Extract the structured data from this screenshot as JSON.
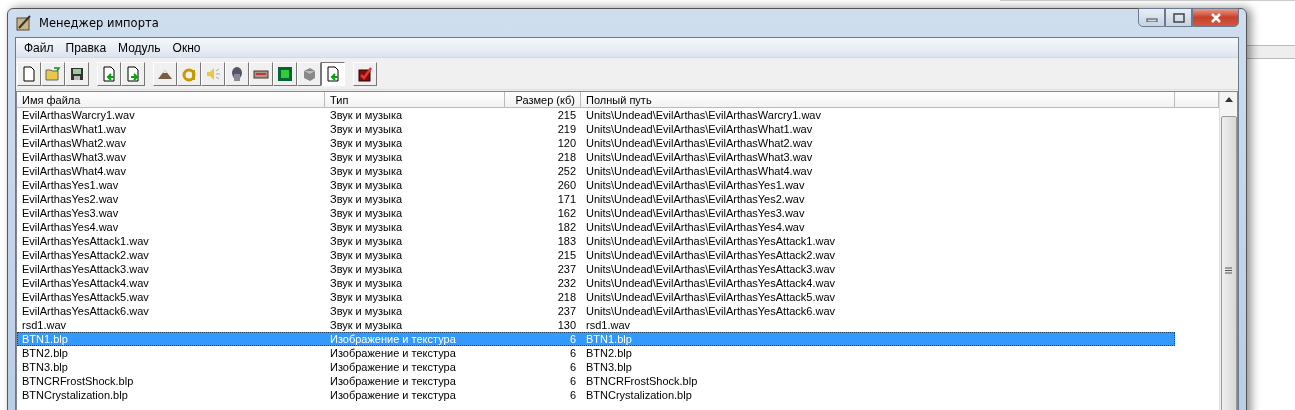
{
  "window": {
    "title": "Менеджер импорта"
  },
  "menu": [
    "Файл",
    "Правка",
    "Модуль",
    "Окно"
  ],
  "toolbar": [
    {
      "pressed": false
    },
    {
      "pressed": false
    },
    {
      "pressed": false
    },
    {
      "pressed": false
    },
    {
      "pressed": false
    },
    {
      "pressed": false
    },
    {
      "pressed": false
    },
    {
      "pressed": false
    },
    {
      "pressed": false
    },
    {
      "pressed": false
    },
    {
      "pressed": false
    },
    {
      "pressed": false
    },
    {
      "pressed": true
    },
    {
      "pressed": false
    }
  ],
  "table": {
    "columns": [
      "Имя файла",
      "Тип",
      "Размер (кб)",
      "Полный путь"
    ],
    "rows": [
      {
        "name": "EvilArthasWarcry1.wav",
        "type": "Звук и музыка",
        "size": "215",
        "path": "Units\\Undead\\EvilArthas\\EvilArthasWarcry1.wav",
        "selected": false
      },
      {
        "name": "EvilArthasWhat1.wav",
        "type": "Звук и музыка",
        "size": "219",
        "path": "Units\\Undead\\EvilArthas\\EvilArthasWhat1.wav",
        "selected": false
      },
      {
        "name": "EvilArthasWhat2.wav",
        "type": "Звук и музыка",
        "size": "120",
        "path": "Units\\Undead\\EvilArthas\\EvilArthasWhat2.wav",
        "selected": false
      },
      {
        "name": "EvilArthasWhat3.wav",
        "type": "Звук и музыка",
        "size": "218",
        "path": "Units\\Undead\\EvilArthas\\EvilArthasWhat3.wav",
        "selected": false
      },
      {
        "name": "EvilArthasWhat4.wav",
        "type": "Звук и музыка",
        "size": "252",
        "path": "Units\\Undead\\EvilArthas\\EvilArthasWhat4.wav",
        "selected": false
      },
      {
        "name": "EvilArthasYes1.wav",
        "type": "Звук и музыка",
        "size": "260",
        "path": "Units\\Undead\\EvilArthas\\EvilArthasYes1.wav",
        "selected": false
      },
      {
        "name": "EvilArthasYes2.wav",
        "type": "Звук и музыка",
        "size": "171",
        "path": "Units\\Undead\\EvilArthas\\EvilArthasYes2.wav",
        "selected": false
      },
      {
        "name": "EvilArthasYes3.wav",
        "type": "Звук и музыка",
        "size": "162",
        "path": "Units\\Undead\\EvilArthas\\EvilArthasYes3.wav",
        "selected": false
      },
      {
        "name": "EvilArthasYes4.wav",
        "type": "Звук и музыка",
        "size": "182",
        "path": "Units\\Undead\\EvilArthas\\EvilArthasYes4.wav",
        "selected": false
      },
      {
        "name": "EvilArthasYesAttack1.wav",
        "type": "Звук и музыка",
        "size": "183",
        "path": "Units\\Undead\\EvilArthas\\EvilArthasYesAttack1.wav",
        "selected": false
      },
      {
        "name": "EvilArthasYesAttack2.wav",
        "type": "Звук и музыка",
        "size": "215",
        "path": "Units\\Undead\\EvilArthas\\EvilArthasYesAttack2.wav",
        "selected": false
      },
      {
        "name": "EvilArthasYesAttack3.wav",
        "type": "Звук и музыка",
        "size": "237",
        "path": "Units\\Undead\\EvilArthas\\EvilArthasYesAttack3.wav",
        "selected": false
      },
      {
        "name": "EvilArthasYesAttack4.wav",
        "type": "Звук и музыка",
        "size": "232",
        "path": "Units\\Undead\\EvilArthas\\EvilArthasYesAttack4.wav",
        "selected": false
      },
      {
        "name": "EvilArthasYesAttack5.wav",
        "type": "Звук и музыка",
        "size": "218",
        "path": "Units\\Undead\\EvilArthas\\EvilArthasYesAttack5.wav",
        "selected": false
      },
      {
        "name": "EvilArthasYesAttack6.wav",
        "type": "Звук и музыка",
        "size": "237",
        "path": "Units\\Undead\\EvilArthas\\EvilArthasYesAttack6.wav",
        "selected": false
      },
      {
        "name": "rsd1.wav",
        "type": "Звук и музыка",
        "size": "130",
        "path": "rsd1.wav",
        "selected": false
      },
      {
        "name": "BTN1.blp",
        "type": "Изображение и текстура",
        "size": "6",
        "path": "BTN1.blp",
        "selected": true
      },
      {
        "name": "BTN2.blp",
        "type": "Изображение и текстура",
        "size": "6",
        "path": "BTN2.blp",
        "selected": false
      },
      {
        "name": "BTN3.blp",
        "type": "Изображение и текстура",
        "size": "6",
        "path": "BTN3.blp",
        "selected": false
      },
      {
        "name": "BTNCRFrostShock.blp",
        "type": "Изображение и текстура",
        "size": "6",
        "path": "BTNCRFrostShock.blp",
        "selected": false
      },
      {
        "name": "BTNCrystalization.blp",
        "type": "Изображение и текстура",
        "size": "6",
        "path": "BTNCrystalization.blp",
        "selected": false
      }
    ]
  }
}
